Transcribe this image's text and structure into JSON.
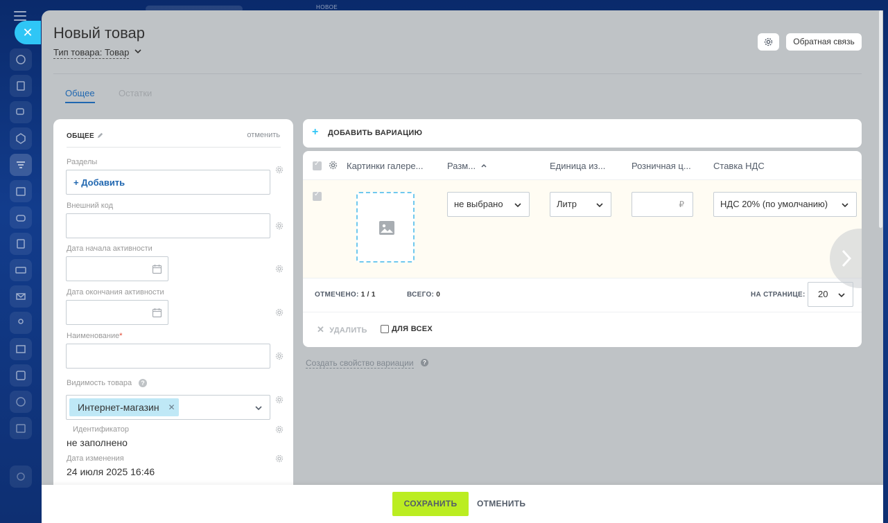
{
  "background": {
    "top_label": "НОВОЕ"
  },
  "header": {
    "title": "Новый товар",
    "product_type": "Тип товара: Товар",
    "feedback_label": "Обратная связь"
  },
  "tabs": [
    {
      "label": "Общее",
      "active": true
    },
    {
      "label": "Остатки",
      "active": false
    }
  ],
  "general_card": {
    "title": "ОБЩЕЕ",
    "cancel_label": "отменить",
    "sections_label": "Разделы",
    "add_label": "+ Добавить",
    "external_code_label": "Внешний код",
    "external_code_value": "",
    "active_from_label": "Дата начала активности",
    "active_to_label": "Дата окончания активности",
    "name_label": "Наименование",
    "name_required_mark": "*",
    "name_value": "",
    "visibility_label": "Видимость товара",
    "visibility_tag": "Интернет-магазин",
    "id_label": "Идентификатор",
    "id_value": "не заполнено",
    "modified_label": "Дата изменения",
    "modified_value": "24 июля 2025 16:46"
  },
  "variations": {
    "add_label": "ДОБАВИТЬ ВАРИАЦИЮ",
    "columns": [
      "Картинки галере...",
      "Разм...",
      "Единица из...",
      "Розничная ц...",
      "Ставка НДС"
    ],
    "row": {
      "size_value": "не выбрано",
      "unit_value": "Литр",
      "price_value": "",
      "currency": "₽",
      "vat_value": "НДС 20% (по умолчанию)"
    },
    "footer": {
      "selected_label": "ОТМЕЧЕНО:",
      "selected_value": "1 / 1",
      "total_label": "ВСЕГО:",
      "total_value": "0",
      "per_page_label": "НА СТРАНИЦЕ:",
      "per_page_value": "20"
    },
    "delete_label": "УДАЛИТЬ",
    "for_all_label": "ДЛЯ ВСЕХ",
    "create_property_label": "Создать свойство вариации"
  },
  "footer": {
    "save_label": "СОХРАНИТЬ",
    "cancel_label": "ОТМЕНИТЬ"
  },
  "colors": {
    "accent_blue": "#2067b0",
    "save_green": "#bbed21",
    "close_cyan": "#2fc6f6"
  }
}
